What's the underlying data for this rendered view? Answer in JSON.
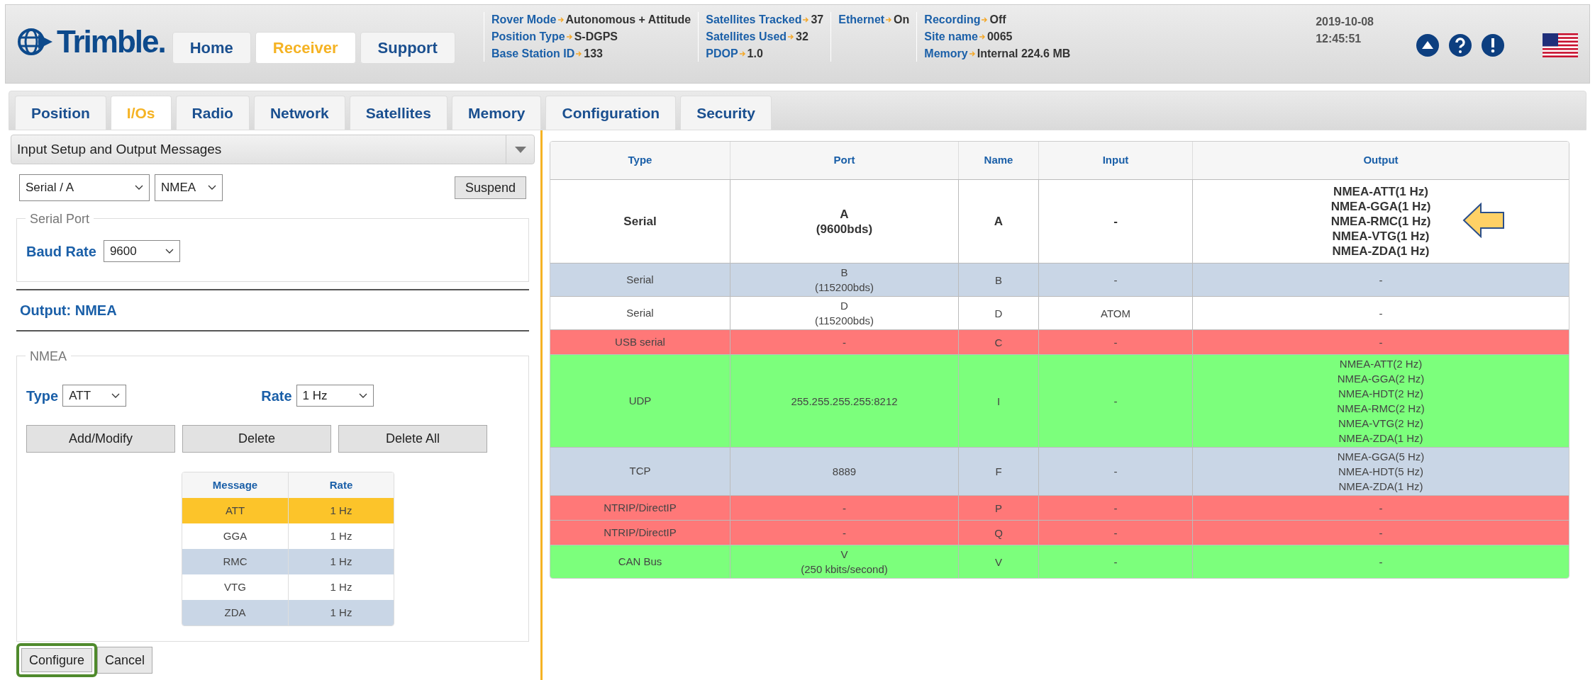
{
  "header": {
    "logo": "Trimble.",
    "nav": [
      {
        "label": "Home",
        "selected": false
      },
      {
        "label": "Receiver",
        "selected": true
      },
      {
        "label": "Support",
        "selected": false
      }
    ],
    "status_groups": [
      [
        {
          "label": "Rover Mode",
          "value": "Autonomous + Attitude"
        },
        {
          "label": "Position Type",
          "value": "S-DGPS"
        },
        {
          "label": "Base Station ID",
          "value": "133"
        }
      ],
      [
        {
          "label": "Satellites Tracked",
          "value": "37"
        },
        {
          "label": "Satellites Used",
          "value": "32"
        },
        {
          "label": "PDOP",
          "value": "1.0"
        }
      ],
      [
        {
          "label": "Ethernet",
          "value": "On"
        }
      ],
      [
        {
          "label": "Recording",
          "value": "Off"
        },
        {
          "label": "Site name",
          "value": "0065"
        },
        {
          "label": "Memory",
          "value": "Internal 224.6 MB"
        }
      ]
    ],
    "date": "2019-10-08",
    "time": "12:45:51"
  },
  "tabs": [
    {
      "label": "Position",
      "selected": false
    },
    {
      "label": "I/Os",
      "selected": true
    },
    {
      "label": "Radio",
      "selected": false
    },
    {
      "label": "Network",
      "selected": false
    },
    {
      "label": "Satellites",
      "selected": false
    },
    {
      "label": "Memory",
      "selected": false
    },
    {
      "label": "Configuration",
      "selected": false
    },
    {
      "label": "Security",
      "selected": false
    }
  ],
  "left": {
    "section_select": "Input Setup and Output Messages",
    "port_select": "Serial / A",
    "protocol_select": "NMEA",
    "suspend_button": "Suspend",
    "serial_port": {
      "legend": "Serial Port",
      "baud_label": "Baud Rate",
      "baud_value": "9600"
    },
    "output_title": "Output: NMEA",
    "nmea": {
      "legend": "NMEA",
      "type_label": "Type",
      "type_value": "ATT",
      "rate_label": "Rate",
      "rate_value": "1 Hz",
      "buttons": [
        "Add/Modify",
        "Delete",
        "Delete All"
      ],
      "columns": [
        "Message",
        "Rate"
      ],
      "rows": [
        {
          "message": "ATT",
          "rate": "1 Hz",
          "selected": true
        },
        {
          "message": "GGA",
          "rate": "1 Hz",
          "selected": false
        },
        {
          "message": "RMC",
          "rate": "1 Hz",
          "selected": false
        },
        {
          "message": "VTG",
          "rate": "1 Hz",
          "selected": false
        },
        {
          "message": "ZDA",
          "rate": "1 Hz",
          "selected": false
        }
      ]
    },
    "configure_button": "Configure",
    "cancel_button": "Cancel"
  },
  "ports_table": {
    "columns": [
      "Type",
      "Port",
      "Name",
      "Input",
      "Output"
    ],
    "rows": [
      {
        "type": "Serial",
        "port": [
          "A",
          "(9600bds)"
        ],
        "name": "A",
        "input": "-",
        "output": [
          "NMEA-ATT(1 Hz)",
          "NMEA-GGA(1 Hz)",
          "NMEA-RMC(1 Hz)",
          "NMEA-VTG(1 Hz)",
          "NMEA-ZDA(1 Hz)"
        ],
        "selected": true,
        "color": "#ffffff"
      },
      {
        "type": "Serial",
        "port": [
          "B",
          "(115200bds)"
        ],
        "name": "B",
        "input": "-",
        "output": [
          "-"
        ],
        "selected": false,
        "color": "#c9d6e6"
      },
      {
        "type": "Serial",
        "port": [
          "D",
          "(115200bds)"
        ],
        "name": "D",
        "input": "ATOM",
        "output": [
          "-"
        ],
        "selected": false,
        "color": "#ffffff"
      },
      {
        "type": "USB serial",
        "port": [
          "-"
        ],
        "name": "C",
        "input": "-",
        "output": [
          "-"
        ],
        "selected": false,
        "color": "#ff7878"
      },
      {
        "type": "UDP",
        "port": [
          "255.255.255.255:8212"
        ],
        "name": "I",
        "input": "-",
        "output": [
          "NMEA-ATT(2 Hz)",
          "NMEA-GGA(2 Hz)",
          "NMEA-HDT(2 Hz)",
          "NMEA-RMC(2 Hz)",
          "NMEA-VTG(2 Hz)",
          "NMEA-ZDA(1 Hz)"
        ],
        "selected": false,
        "color": "#7cff7c"
      },
      {
        "type": "TCP",
        "port": [
          "8889"
        ],
        "name": "F",
        "input": "-",
        "output": [
          "NMEA-GGA(5 Hz)",
          "NMEA-HDT(5 Hz)",
          "NMEA-ZDA(1 Hz)"
        ],
        "selected": false,
        "color": "#c9d6e6"
      },
      {
        "type": "NTRIP/DirectIP",
        "port": [
          "-"
        ],
        "name": "P",
        "input": "-",
        "output": [
          "-"
        ],
        "selected": false,
        "color": "#ff7878"
      },
      {
        "type": "NTRIP/DirectIP",
        "port": [
          "-"
        ],
        "name": "Q",
        "input": "-",
        "output": [
          "-"
        ],
        "selected": false,
        "color": "#ff7878"
      },
      {
        "type": "CAN Bus",
        "port": [
          "V",
          "(250 kbits/second)"
        ],
        "name": "V",
        "input": "-",
        "output": [
          "-"
        ],
        "selected": false,
        "color": "#7cff7c"
      }
    ]
  }
}
